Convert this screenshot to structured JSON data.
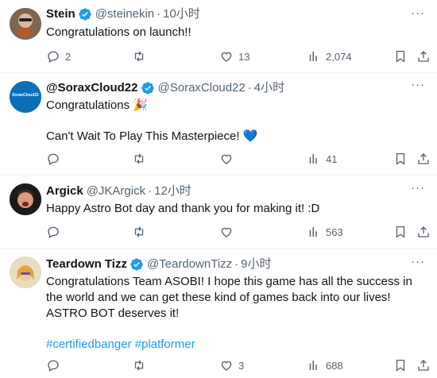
{
  "colors": {
    "accent": "#1d9bf0",
    "muted": "#536471",
    "text": "#0f1419",
    "verified": "#1d9bf0"
  },
  "replies": [
    {
      "name": "Stein",
      "handle": "@steinekin",
      "time": "10小时",
      "verified": true,
      "text": [
        "Congratulations on launch!!"
      ],
      "hashtags": "",
      "stats": {
        "replies": "2",
        "reposts": "",
        "likes": "13",
        "views": "2,074"
      }
    },
    {
      "name": "@SoraxCloud22",
      "handle": "@SoraxCloud22",
      "time": "4小时",
      "verified": true,
      "avatar_text": "SoraxCloud22",
      "text": [
        "Congratulations 🎉",
        "Can't Wait To Play This Masterpiece! 💙"
      ],
      "hashtags": "",
      "stats": {
        "replies": "",
        "reposts": "",
        "likes": "",
        "views": "41"
      }
    },
    {
      "name": "Argick",
      "handle": "@JKArgick",
      "time": "12小时",
      "verified": false,
      "text": [
        "Happy Astro Bot day and thank you for making it! :D"
      ],
      "hashtags": "",
      "stats": {
        "replies": "",
        "reposts": "",
        "likes": "",
        "views": "563"
      }
    },
    {
      "name": "Teardown Tizz",
      "handle": "@TeardownTizz",
      "time": "9小时",
      "verified": true,
      "text": [
        "Congratulations Team ASOBI! I hope this game has all the success in the world and we can get these kind of games back into our lives! ASTRO BOT deserves it!"
      ],
      "hashtags": "#certifiedbanger #platformer",
      "stats": {
        "replies": "",
        "reposts": "",
        "likes": "3",
        "views": "688"
      }
    }
  ],
  "dot": "·",
  "more": "···"
}
